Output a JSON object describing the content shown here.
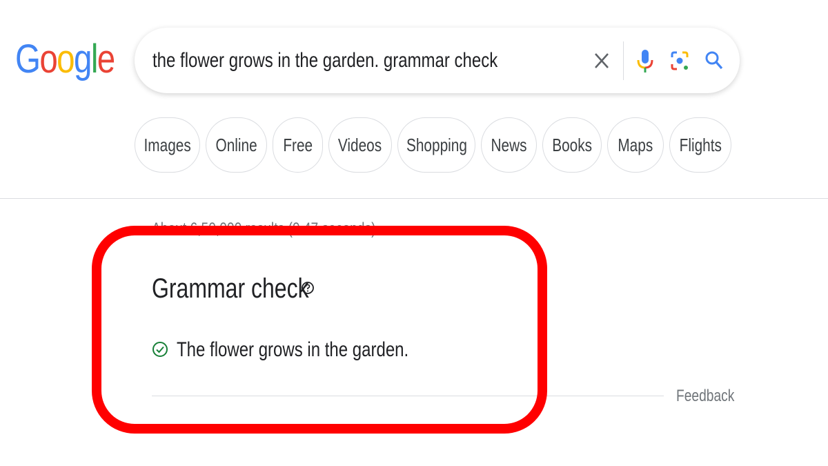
{
  "logo": {
    "text": "Google",
    "colors": [
      "#4285f4",
      "#ea4335",
      "#fbbc05",
      "#4285f4",
      "#34a853",
      "#ea4335"
    ]
  },
  "search": {
    "query": "the flower grows in the garden. grammar check",
    "icons": [
      "close-icon",
      "mic-icon",
      "lens-icon",
      "search-icon"
    ]
  },
  "chips": [
    "Images",
    "Online",
    "Free",
    "Videos",
    "Shopping",
    "News",
    "Books",
    "Maps",
    "Flights"
  ],
  "results": {
    "stats": "About 6,50,000 results (0.47 seconds)"
  },
  "grammar": {
    "title": "Grammar check",
    "result": "The flower grows in the garden.",
    "feedback": "Feedback",
    "check_color": "#188038"
  },
  "annotation": {
    "color": "#ff0000"
  }
}
